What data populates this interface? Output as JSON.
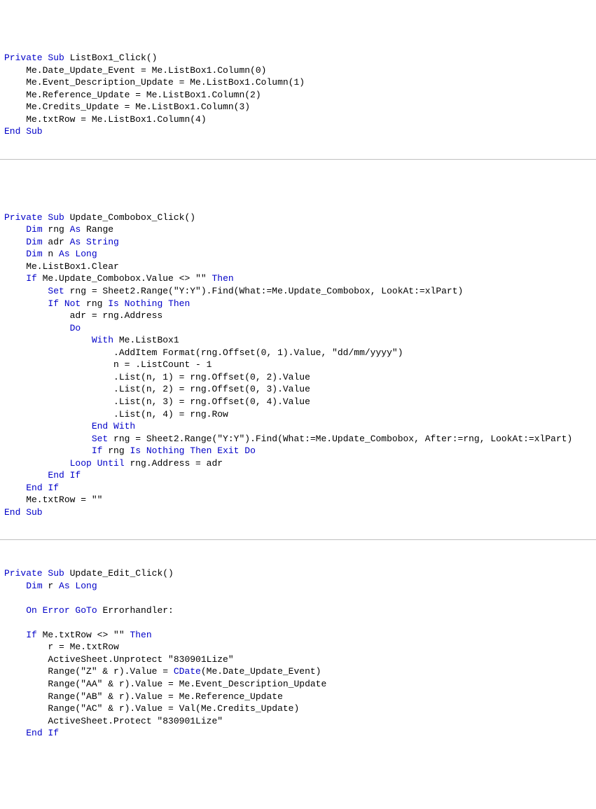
{
  "code": {
    "seg1": [
      {
        "t": "Private Sub",
        "c": "kw"
      },
      {
        "t": " ListBox1_Click()\n"
      },
      {
        "t": "    Me.Date_Update_Event = Me.ListBox1.Column(0)\n"
      },
      {
        "t": "    Me.Event_Description_Update = Me.ListBox1.Column(1)\n"
      },
      {
        "t": "    Me.Reference_Update = Me.ListBox1.Column(2)\n"
      },
      {
        "t": "    Me.Credits_Update = Me.ListBox1.Column(3)\n"
      },
      {
        "t": "    Me.txtRow = Me.ListBox1.Column(4)\n"
      },
      {
        "t": "End Sub",
        "c": "kw"
      }
    ],
    "seg2": [
      {
        "t": "\n\n\n"
      },
      {
        "t": "Private Sub",
        "c": "kw"
      },
      {
        "t": " Update_Combobox_Click()\n"
      },
      {
        "t": "    "
      },
      {
        "t": "Dim",
        "c": "kw"
      },
      {
        "t": " rng "
      },
      {
        "t": "As",
        "c": "kw"
      },
      {
        "t": " Range\n"
      },
      {
        "t": "    "
      },
      {
        "t": "Dim",
        "c": "kw"
      },
      {
        "t": " adr "
      },
      {
        "t": "As String",
        "c": "kw"
      },
      {
        "t": "\n"
      },
      {
        "t": "    "
      },
      {
        "t": "Dim",
        "c": "kw"
      },
      {
        "t": " n "
      },
      {
        "t": "As Long",
        "c": "kw"
      },
      {
        "t": "\n"
      },
      {
        "t": "    Me.ListBox1.Clear\n"
      },
      {
        "t": "    "
      },
      {
        "t": "If",
        "c": "kw"
      },
      {
        "t": " Me.Update_Combobox.Value <> \"\" "
      },
      {
        "t": "Then",
        "c": "kw"
      },
      {
        "t": "\n"
      },
      {
        "t": "        "
      },
      {
        "t": "Set",
        "c": "kw"
      },
      {
        "t": " rng = Sheet2.Range(\"Y:Y\").Find(What:=Me.Update_Combobox, LookAt:=xlPart)\n"
      },
      {
        "t": "        "
      },
      {
        "t": "If Not",
        "c": "kw"
      },
      {
        "t": " rng "
      },
      {
        "t": "Is Nothing Then",
        "c": "kw"
      },
      {
        "t": "\n"
      },
      {
        "t": "            adr = rng.Address\n"
      },
      {
        "t": "            "
      },
      {
        "t": "Do",
        "c": "kw"
      },
      {
        "t": "\n"
      },
      {
        "t": "                "
      },
      {
        "t": "With",
        "c": "kw"
      },
      {
        "t": " Me.ListBox1\n"
      },
      {
        "t": "                    .AddItem Format(rng.Offset(0, 1).Value, \"dd/mm/yyyy\")\n"
      },
      {
        "t": "                    n = .ListCount - 1\n"
      },
      {
        "t": "                    .List(n, 1) = rng.Offset(0, 2).Value\n"
      },
      {
        "t": "                    .List(n, 2) = rng.Offset(0, 3).Value\n"
      },
      {
        "t": "                    .List(n, 3) = rng.Offset(0, 4).Value\n"
      },
      {
        "t": "                    .List(n, 4) = rng.Row\n"
      },
      {
        "t": "                "
      },
      {
        "t": "End With",
        "c": "kw"
      },
      {
        "t": "\n"
      },
      {
        "t": "                "
      },
      {
        "t": "Set",
        "c": "kw"
      },
      {
        "t": " rng = Sheet2.Range(\"Y:Y\").Find(What:=Me.Update_Combobox, After:=rng, LookAt:=xlPart)\n"
      },
      {
        "t": "                "
      },
      {
        "t": "If",
        "c": "kw"
      },
      {
        "t": " rng "
      },
      {
        "t": "Is Nothing Then Exit Do",
        "c": "kw"
      },
      {
        "t": "\n"
      },
      {
        "t": "            "
      },
      {
        "t": "Loop Until",
        "c": "kw"
      },
      {
        "t": " rng.Address = adr\n"
      },
      {
        "t": "        "
      },
      {
        "t": "End If",
        "c": "kw"
      },
      {
        "t": "\n"
      },
      {
        "t": "    "
      },
      {
        "t": "End If",
        "c": "kw"
      },
      {
        "t": "\n"
      },
      {
        "t": "    Me.txtRow = \"\"\n"
      },
      {
        "t": "End Sub",
        "c": "kw"
      }
    ],
    "seg3": [
      {
        "t": "\n"
      },
      {
        "t": "Private Sub",
        "c": "kw"
      },
      {
        "t": " Update_Edit_Click()\n"
      },
      {
        "t": "    "
      },
      {
        "t": "Dim",
        "c": "kw"
      },
      {
        "t": " r "
      },
      {
        "t": "As Long",
        "c": "kw"
      },
      {
        "t": "\n"
      },
      {
        "t": "\n"
      },
      {
        "t": "    "
      },
      {
        "t": "On Error GoTo",
        "c": "kw"
      },
      {
        "t": " Errorhandler:\n"
      },
      {
        "t": "\n"
      },
      {
        "t": "    "
      },
      {
        "t": "If",
        "c": "kw"
      },
      {
        "t": " Me.txtRow <> \"\" "
      },
      {
        "t": "Then",
        "c": "kw"
      },
      {
        "t": "\n"
      },
      {
        "t": "        r = Me.txtRow\n"
      },
      {
        "t": "        ActiveSheet.Unprotect \"830901Lize\"\n"
      },
      {
        "t": "        Range(\"Z\" & r).Value = "
      },
      {
        "t": "CDate",
        "c": "kw"
      },
      {
        "t": "(Me.Date_Update_Event)\n"
      },
      {
        "t": "        Range(\"AA\" & r).Value = Me.Event_Description_Update\n"
      },
      {
        "t": "        Range(\"AB\" & r).Value = Me.Reference_Update\n"
      },
      {
        "t": "        Range(\"AC\" & r).Value = Val(Me.Credits_Update)\n"
      },
      {
        "t": "        ActiveSheet.Protect \"830901Lize\"\n"
      },
      {
        "t": "    "
      },
      {
        "t": "End If",
        "c": "kw"
      }
    ]
  }
}
